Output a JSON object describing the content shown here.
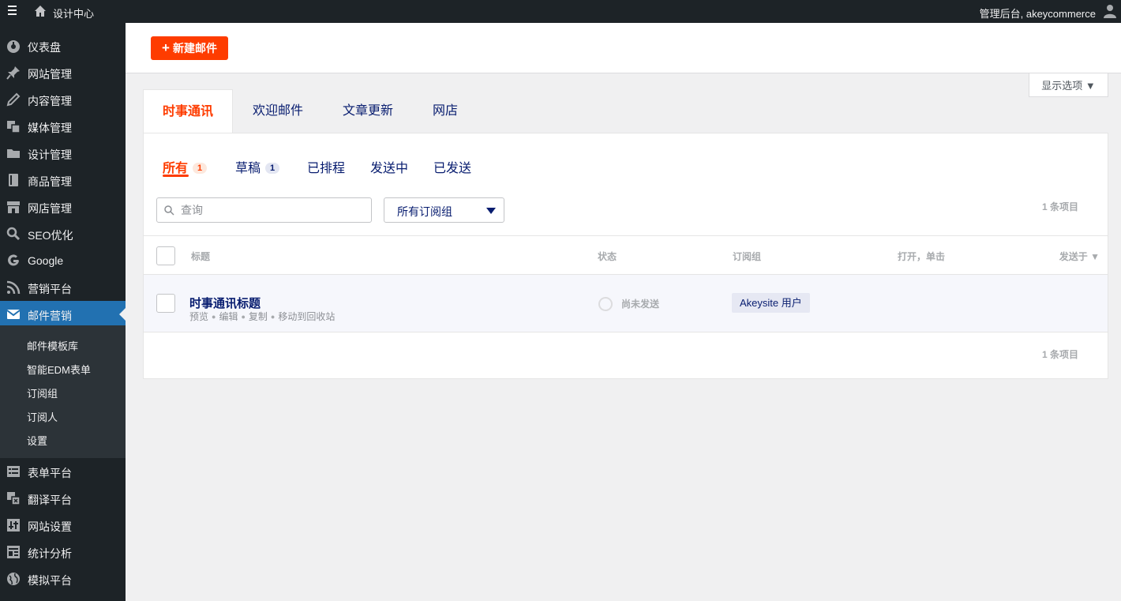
{
  "topbar": {
    "site_name": "设计中心",
    "account": "管理后台, akeycommerce"
  },
  "sidebar": {
    "items": [
      {
        "label": "仪表盘",
        "icon": "dashboard-icon"
      },
      {
        "label": "网站管理",
        "icon": "pin-icon"
      },
      {
        "label": "内容管理",
        "icon": "pencil-icon"
      },
      {
        "label": "媒体管理",
        "icon": "media-icon"
      },
      {
        "label": "设计管理",
        "icon": "folder-icon"
      },
      {
        "label": "商品管理",
        "icon": "book-icon"
      },
      {
        "label": "网店管理",
        "icon": "store-icon"
      },
      {
        "label": "SEO优化",
        "icon": "search-icon"
      },
      {
        "label": "Google",
        "icon": "google-icon"
      },
      {
        "label": "营销平台",
        "icon": "rss-icon"
      },
      {
        "label": "邮件营销",
        "icon": "mail-icon"
      },
      {
        "label": "表单平台",
        "icon": "form-icon"
      },
      {
        "label": "翻译平台",
        "icon": "translate-icon"
      },
      {
        "label": "网站设置",
        "icon": "settings-icon"
      },
      {
        "label": "统计分析",
        "icon": "analytics-icon"
      },
      {
        "label": "模拟平台",
        "icon": "globe-icon"
      }
    ],
    "submenu": [
      "邮件模板库",
      "智能EDM表单",
      "订阅组",
      "订阅人",
      "设置"
    ]
  },
  "header": {
    "new_button": "新建邮件",
    "screen_options": "显示选项 ▼"
  },
  "top_tabs": [
    "时事通讯",
    "欢迎邮件",
    "文章更新",
    "网店"
  ],
  "sub_tabs": [
    {
      "label": "所有",
      "badge": "1"
    },
    {
      "label": "草稿",
      "badge": "1"
    },
    {
      "label": "已排程"
    },
    {
      "label": "发送中"
    },
    {
      "label": "已发送"
    }
  ],
  "filters": {
    "search_placeholder": "查询",
    "group_select": "所有订阅组"
  },
  "count_top": "1 条项目",
  "count_bottom": "1 条项目",
  "table": {
    "columns": [
      "标题",
      "状态",
      "订阅组",
      "打开，单击",
      "发送于 ▼"
    ],
    "rows": [
      {
        "title": "时事通讯标题",
        "actions": [
          "预览",
          "编辑",
          "复制",
          "移动到回收站"
        ],
        "status": "尚未发送",
        "group": "Akeysite 用户"
      }
    ]
  },
  "colors": {
    "accent": "#fe3c00",
    "navy": "#071c6f",
    "admin_blue": "#2271b1",
    "sidebar_bg": "#1d2327"
  }
}
